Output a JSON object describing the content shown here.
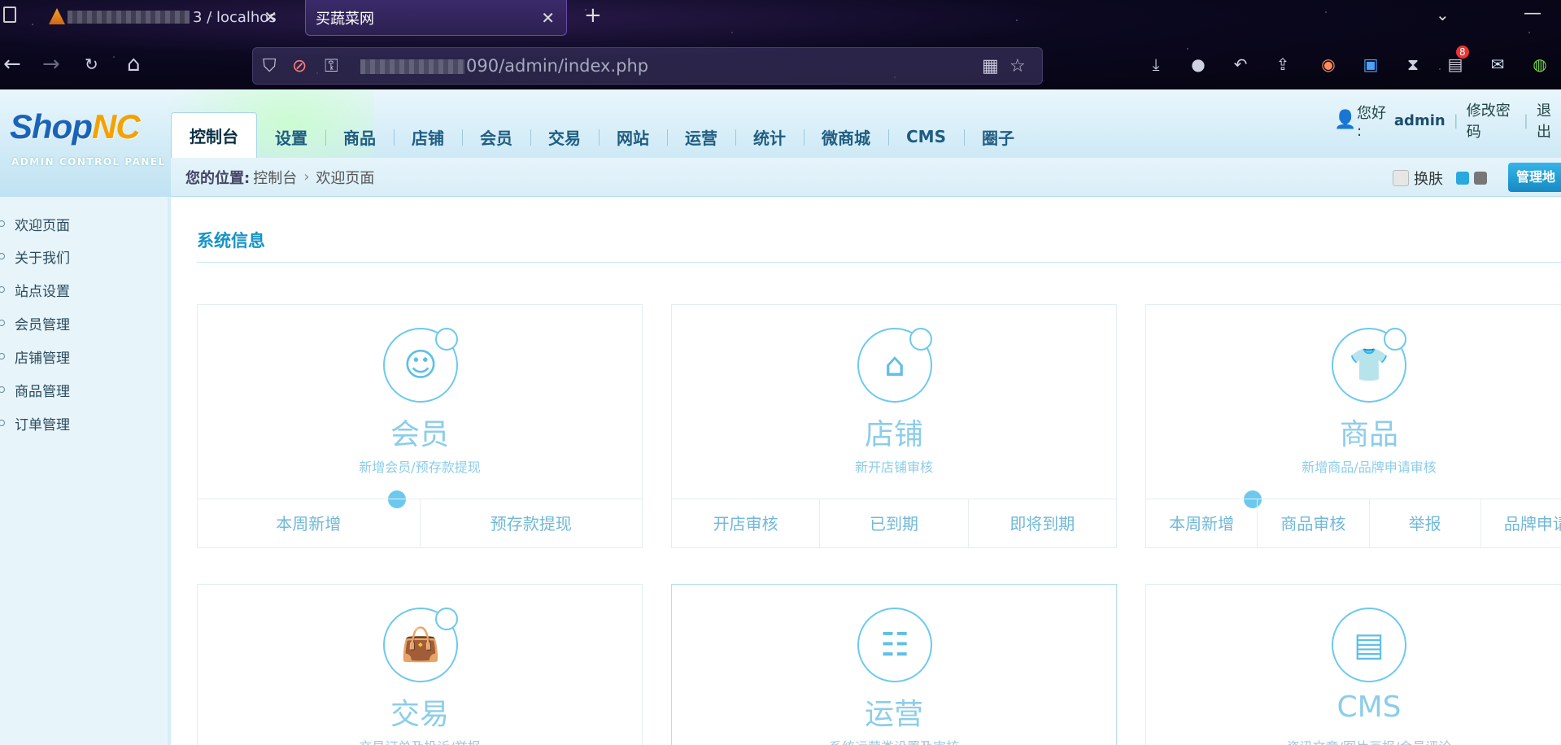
{
  "browser": {
    "tabs": [
      {
        "title": "3 / localhos"
      },
      {
        "title": "买蔬菜网"
      }
    ],
    "url": "090/admin/index.php",
    "extension_badge": "8"
  },
  "app": {
    "logo": {
      "shop": "Shop",
      "nc": "NC",
      "subtitle": "ADMIN CONTROL PANEL"
    },
    "nav": [
      "控制台",
      "设置",
      "商品",
      "店铺",
      "会员",
      "交易",
      "网站",
      "运营",
      "统计",
      "微商城",
      "CMS",
      "圈子"
    ],
    "user": {
      "greeting": "您好 :",
      "name": "admin",
      "change_password": "修改密码",
      "logout": "退出"
    },
    "breadcrumb": {
      "label": "您的位置:",
      "root": "控制台",
      "current": "欢迎页面"
    },
    "skin_label": "换肤",
    "manage_label": "管理地",
    "colors": {
      "accent": "#1593c8",
      "skin_blue": "#2aa8e0",
      "skin_gray": "#777777"
    }
  },
  "sidebar": {
    "items": [
      "欢迎页面",
      "关于我们",
      "站点设置",
      "会员管理",
      "店铺管理",
      "商品管理",
      "订单管理"
    ]
  },
  "content": {
    "section_title": "系统信息",
    "cards": [
      {
        "icon": "member-icon",
        "title": "会员",
        "subtitle": "新增会员/预存款提现",
        "tabs": [
          "本周新增",
          "预存款提现"
        ]
      },
      {
        "icon": "store-icon",
        "title": "店铺",
        "subtitle": "新开店铺审核",
        "tabs": [
          "开店审核",
          "已到期",
          "即将到期"
        ]
      },
      {
        "icon": "goods-icon",
        "title": "商品",
        "subtitle": "新增商品/品牌申请审核",
        "tabs": [
          "本周新增",
          "商品审核",
          "举报",
          "品牌申请"
        ]
      },
      {
        "icon": "trade-icon",
        "title": "交易",
        "subtitle": "交易订单及投诉/举报",
        "tabs": []
      },
      {
        "icon": "operation-icon",
        "title": "运营",
        "subtitle": "系统运营类设置及审核",
        "tabs": []
      },
      {
        "icon": "cms-icon",
        "title": "CMS",
        "subtitle": "资讯文章/图片画报/会员评论",
        "tabs": []
      }
    ]
  }
}
